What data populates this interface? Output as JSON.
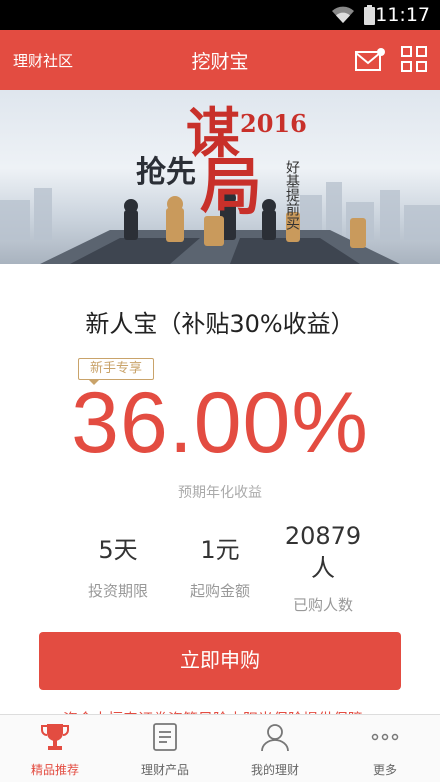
{
  "status_bar": {
    "time": "11:17"
  },
  "header": {
    "left_link": "理财社区",
    "title": "挖财宝",
    "bg_color": "#e34c41"
  },
  "banner": {
    "headline_main": "谋",
    "headline_big": "局",
    "headline_sub": "抢先",
    "year": "2016",
    "side_text": "好基提前买"
  },
  "product": {
    "name": "新人宝（补贴30%收益）",
    "tag": "新手专享",
    "rate": "36.00%",
    "rate_label": "预期年化收益",
    "stats": [
      {
        "value": "5天",
        "label": "投资期限"
      },
      {
        "value": "1元",
        "label": "起购金额"
      },
      {
        "value": "20879",
        "value2": "人",
        "label": "已购人数"
      }
    ],
    "buy_label": "立即申购",
    "disclaimer": "资金由恒泰证券资管风险由阳光保险提供保障"
  },
  "tabs": [
    {
      "label": "精品推荐",
      "icon": "trophy-icon",
      "active": true
    },
    {
      "label": "理财产品",
      "icon": "document-icon",
      "active": false
    },
    {
      "label": "我的理财",
      "icon": "person-icon",
      "active": false
    },
    {
      "label": "更多",
      "icon": "more-icon",
      "active": false
    }
  ],
  "colors": {
    "accent": "#e34c41",
    "gold": "#c9a36a"
  }
}
